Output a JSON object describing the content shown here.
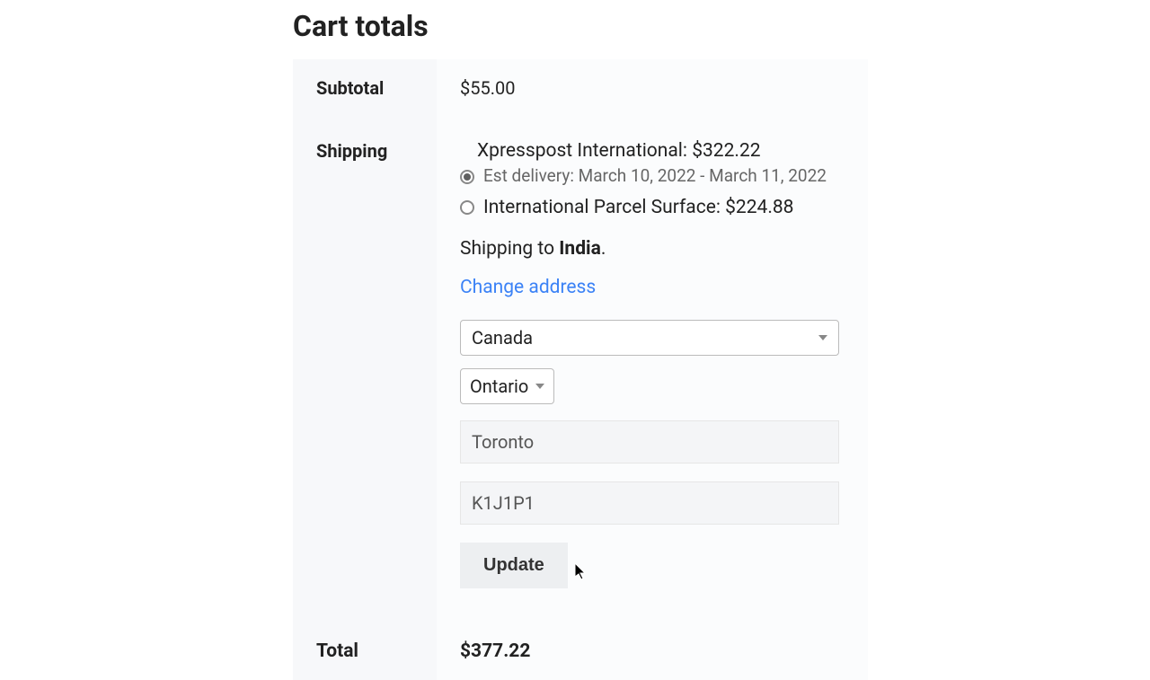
{
  "title": "Cart totals",
  "subtotal": {
    "label": "Subtotal",
    "value": "$55.00"
  },
  "shipping": {
    "label": "Shipping",
    "options": [
      {
        "label": "Xpresspost International: $322.22",
        "delivery": "Est delivery: March 10, 2022 - March 11, 2022",
        "selected": true
      },
      {
        "label": "International Parcel Surface: $224.88",
        "selected": false
      }
    ],
    "shipping_to_prefix": "Shipping to ",
    "shipping_to_country": "India",
    "shipping_to_suffix": ".",
    "change_address_label": "Change address",
    "form": {
      "country": "Canada",
      "province": "Ontario",
      "city": "Toronto",
      "postal": "K1J1P1",
      "update_label": "Update"
    }
  },
  "total": {
    "label": "Total",
    "value": "$377.22"
  }
}
